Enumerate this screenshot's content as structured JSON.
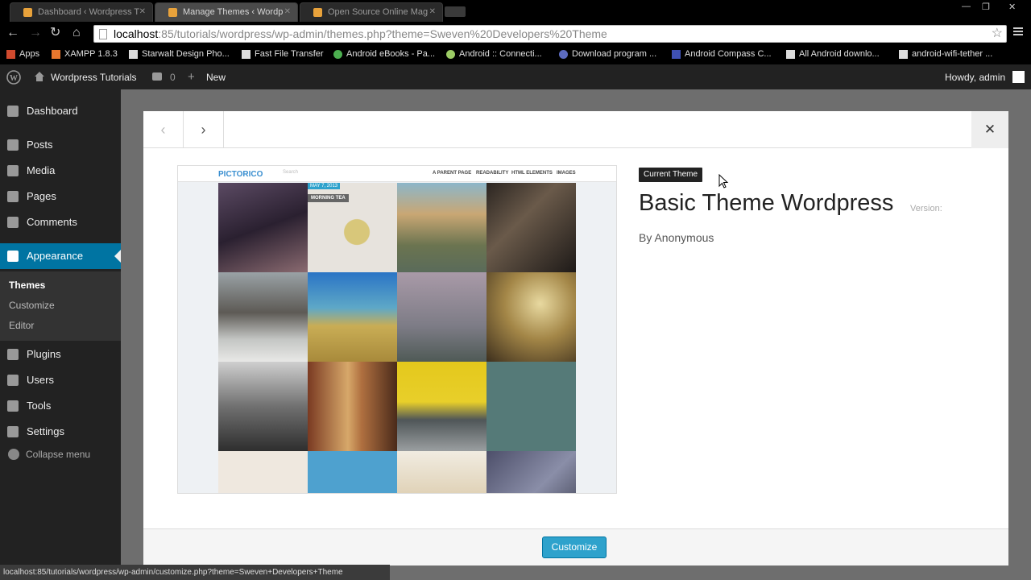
{
  "browser": {
    "tabs": [
      {
        "title": "Dashboard ‹ Wordpress T"
      },
      {
        "title": "Manage Themes ‹ Wordp"
      },
      {
        "title": "Open Source Online Mag"
      }
    ],
    "window_controls": [
      "—",
      "❐",
      "✕"
    ],
    "url_host": "localhost",
    "url_path": ":85/tutorials/wordpress/wp-admin/themes.php?theme=Sweven%20Developers%20Theme",
    "bookmarks": [
      "Apps",
      "XAMPP 1.8.3",
      "Starwalt Design Pho...",
      "Fast File Transfer",
      "Android eBooks - Pa...",
      "Android :: Connecti...",
      "Download program ...",
      "Android Compass C...",
      "All Android downlo...",
      "android-wifi-tether ..."
    ],
    "status_url": "localhost:85/tutorials/wordpress/wp-admin/customize.php?theme=Sweven+Developers+Theme"
  },
  "adminbar": {
    "site_name": "Wordpress Tutorials",
    "comments_count": "0",
    "new_label": "New",
    "howdy": "Howdy, admin"
  },
  "sidebar": {
    "items": [
      {
        "label": "Dashboard"
      },
      {
        "label": "Posts"
      },
      {
        "label": "Media"
      },
      {
        "label": "Pages"
      },
      {
        "label": "Comments"
      },
      {
        "label": "Appearance"
      },
      {
        "label": "Plugins"
      },
      {
        "label": "Users"
      },
      {
        "label": "Tools"
      },
      {
        "label": "Settings"
      }
    ],
    "submenu": [
      "Themes",
      "Customize",
      "Editor"
    ],
    "collapse": "Collapse menu"
  },
  "modal": {
    "prev_icon": "‹",
    "next_icon": "›",
    "close_icon": "✕",
    "current_badge": "Current Theme",
    "theme_name": "Basic Theme Wordpress",
    "version_label": "Version:",
    "author": "By Anonymous",
    "customize_label": "Customize"
  },
  "preview": {
    "logo": "PICTORICO",
    "search": "Search",
    "nav": [
      "A PARENT PAGE",
      "READABILITY",
      "HTML ELEMENTS",
      "IMAGES"
    ],
    "date_tag": "MAY 7, 2013",
    "post_tag": "MORNING TEA"
  },
  "colors": {
    "accent": "#0074a2",
    "button": "#2ea2cc",
    "adminbar": "#222222"
  }
}
